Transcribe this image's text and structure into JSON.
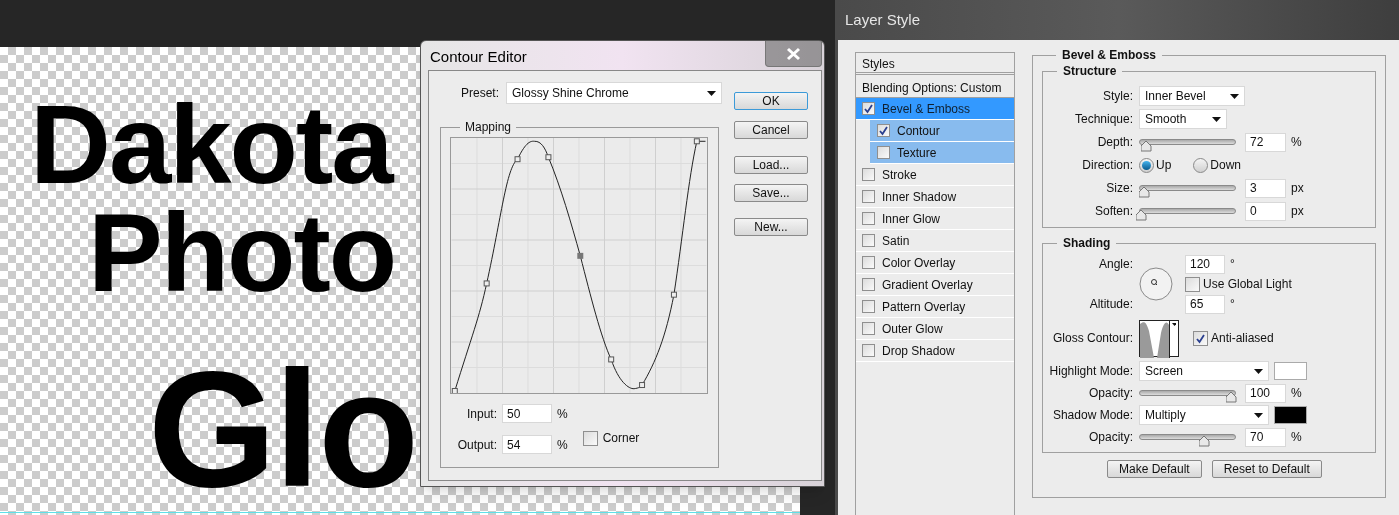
{
  "canvas": {
    "texts": [
      "Dakota",
      "Photo",
      "Glo"
    ]
  },
  "contour_editor": {
    "title": "Contour Editor",
    "preset": {
      "label": "Preset:",
      "value": "Glossy Shine Chrome"
    },
    "mapping": {
      "title": "Mapping"
    },
    "input": {
      "label": "Input:",
      "value": "50",
      "unit": "%"
    },
    "output": {
      "label": "Output:",
      "value": "54",
      "unit": "%"
    },
    "corner": {
      "label": "Corner",
      "checked": false
    },
    "buttons": [
      {
        "label": "OK",
        "default": true
      },
      {
        "label": "Cancel",
        "default": false
      },
      {
        "label": "Load...",
        "default": false
      },
      {
        "label": "Save...",
        "default": false
      },
      {
        "label": "New...",
        "default": false
      }
    ]
  },
  "layer_style": {
    "title": "Layer Style",
    "styles_header": "Styles",
    "blending_options": "Blending Options: Custom",
    "effects": [
      {
        "label": "Bevel & Emboss",
        "checked": true,
        "selected": true,
        "children": [
          {
            "label": "Contour",
            "checked": true,
            "selected": false
          },
          {
            "label": "Texture",
            "checked": false,
            "selected": false
          }
        ]
      },
      {
        "label": "Stroke",
        "checked": false,
        "selected": false
      },
      {
        "label": "Inner Shadow",
        "checked": false,
        "selected": false
      },
      {
        "label": "Inner Glow",
        "checked": false,
        "selected": false
      },
      {
        "label": "Satin",
        "checked": false,
        "selected": false
      },
      {
        "label": "Color Overlay",
        "checked": false,
        "selected": false
      },
      {
        "label": "Gradient Overlay",
        "checked": false,
        "selected": false
      },
      {
        "label": "Pattern Overlay",
        "checked": false,
        "selected": false
      },
      {
        "label": "Outer Glow",
        "checked": false,
        "selected": false
      },
      {
        "label": "Drop Shadow",
        "checked": false,
        "selected": false
      }
    ],
    "bevel_emboss": {
      "title": "Bevel & Emboss",
      "structure": {
        "title": "Structure",
        "style": {
          "label": "Style:",
          "value": "Inner Bevel"
        },
        "technique": {
          "label": "Technique:",
          "value": "Smooth"
        },
        "depth": {
          "label": "Depth:",
          "level": 0.06,
          "value": "72",
          "unit": "%"
        },
        "direction": {
          "label": "Direction:",
          "options": [
            {
              "label": "Up",
              "selected": true
            },
            {
              "label": "Down",
              "selected": false
            }
          ]
        },
        "size": {
          "label": "Size:",
          "level": 0.03,
          "value": "3",
          "unit": "px"
        },
        "soften": {
          "label": "Soften:",
          "level": 0,
          "value": "0",
          "unit": "px"
        }
      },
      "shading": {
        "title": "Shading",
        "angle": {
          "label": "Angle:",
          "value": "120",
          "unit": "°"
        },
        "use_global_light": {
          "label": "Use Global Light",
          "checked": false
        },
        "altitude": {
          "label": "Altitude:",
          "value": "65",
          "unit": "°"
        },
        "gloss_contour": {
          "label": "Gloss Contour:"
        },
        "anti_aliased": {
          "label": "Anti-aliased",
          "checked": true
        },
        "highlight_mode": {
          "label": "Highlight Mode:",
          "value": "Screen",
          "color": "#ffffff"
        },
        "highlight_opacity": {
          "label": "Opacity:",
          "level": 1,
          "value": "100",
          "unit": "%"
        },
        "shadow_mode": {
          "label": "Shadow Mode:",
          "value": "Multiply",
          "color": "#000000"
        },
        "shadow_opacity": {
          "label": "Opacity:",
          "level": 0.7,
          "value": "70",
          "unit": "%"
        }
      }
    },
    "buttons": [
      "Make Default",
      "Reset to Default"
    ]
  }
}
